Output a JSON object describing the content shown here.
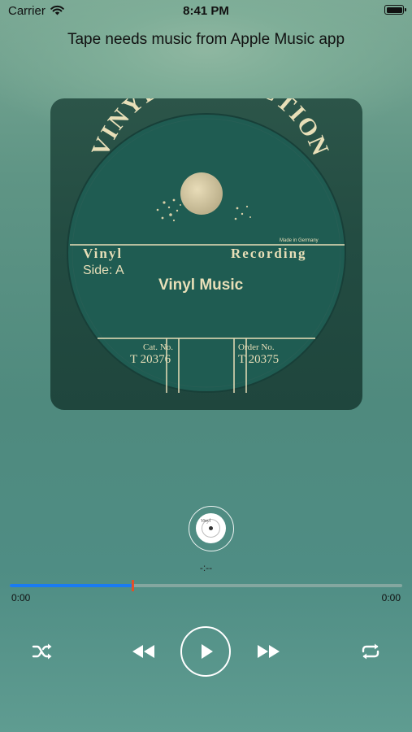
{
  "status_bar": {
    "carrier": "Carrier",
    "time": "8:41 PM",
    "icons": [
      "wifi-icon",
      "battery-icon"
    ]
  },
  "notice": "Tape needs music from Apple Music app",
  "album_art": {
    "arc_title": "VINYL COLLECTION",
    "made_in": "Made in Germany",
    "left_title": "Vinyl",
    "side": "Side: A",
    "right_title": "Recording",
    "track_title": "Vinyl Music",
    "cat_label": "Cat. No.",
    "cat_number": "T 20376",
    "order_label": "Order No.",
    "order_number": "T 20375",
    "speaker_label": "Vinyl"
  },
  "player": {
    "remaining_time": "-:--",
    "start_time": "0:00",
    "end_time": "0:00",
    "progress_fraction": 0.31
  },
  "controls": {
    "icons": [
      "shuffle-icon",
      "rewind-icon",
      "play-icon",
      "fast-forward-icon",
      "repeat-icon"
    ]
  },
  "colors": {
    "progress": "#1a7bf2",
    "thumb": "#e0502a",
    "label_cream": "#e8dfb8",
    "disc_green": "#1f5c52"
  }
}
